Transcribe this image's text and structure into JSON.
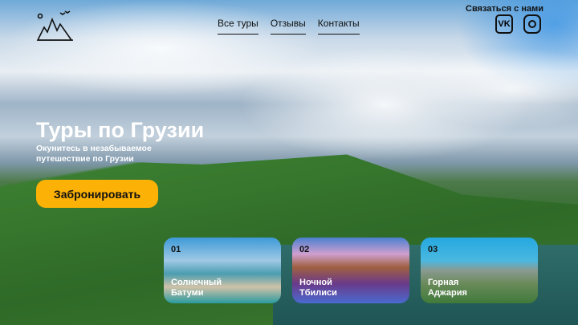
{
  "nav": {
    "items": [
      "Все туры",
      "Отзывы",
      "Контакты"
    ]
  },
  "contact": {
    "label": "Связаться с нами",
    "vk": "VK",
    "instagram": "Instagram"
  },
  "hero": {
    "title": "Туры по Грузии",
    "subtitle": "Окунитесь в незабываемое путешествие по Грузии",
    "button": "Забронировать"
  },
  "cards": [
    {
      "num": "01",
      "title": "Солнечный Батуми"
    },
    {
      "num": "02",
      "title": "Ночной Тбилиси"
    },
    {
      "num": "03",
      "title": "Горная Аджария"
    }
  ]
}
